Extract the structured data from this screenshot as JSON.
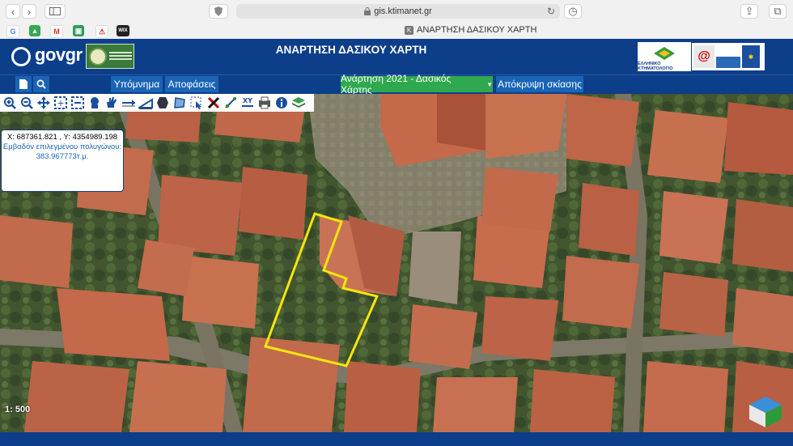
{
  "browser": {
    "url": "gis.ktimanet.gr",
    "tab_title": "ΑΝΑΡΤΗΣΗ ΔΑΣΙΚΟΥ ΧΑΡΤΗ",
    "favicon_letter": "K",
    "bookmark_wikx": "WIX"
  },
  "header": {
    "gov_logo_text": "govgr",
    "title": "ΑΝΑΡΤΗΣΗ ΔΑΣΙΚΟΥ ΧΑΡΤΗ",
    "ktimatologio_label": "ΕΛΛΗΝΙΚΟ ΚΤΗΜΑΤΟΛΟΓΙΟ"
  },
  "nav": {
    "legend_label": "Υπόμνημα",
    "decisions_label": "Αποφάσεις",
    "map_select_label": "Ανάρτηση 2021 - Δασικός Χάρτης",
    "hide_shading_label": "Απόκρυψη σκίασης"
  },
  "info_box": {
    "coords": "X: 687361.821 , Y: 4354989.198",
    "area_label": "Εμβαδόν επιλεγμένου πολυγώνου:",
    "area_value": "383.967773τ.μ."
  },
  "map": {
    "scale": "1: 500",
    "polygon_color": "#f5e60c"
  },
  "colors": {
    "brand_blue": "#0c3e8a",
    "nav_button": "#1a64b5",
    "green_button": "#2fa84f"
  },
  "icons": [
    "zoom-in-icon",
    "zoom-out-icon",
    "pan-icon",
    "zoom-box-icon",
    "zoom-box-out-icon",
    "identify-icon",
    "hand-icon",
    "measure-distance-icon",
    "measure-area-icon",
    "polygon-icon",
    "select-polygon-icon",
    "select-arrow-icon",
    "clear-icon",
    "draw-icon",
    "xy-coords-icon",
    "print-icon",
    "info-icon",
    "layers-icon"
  ]
}
